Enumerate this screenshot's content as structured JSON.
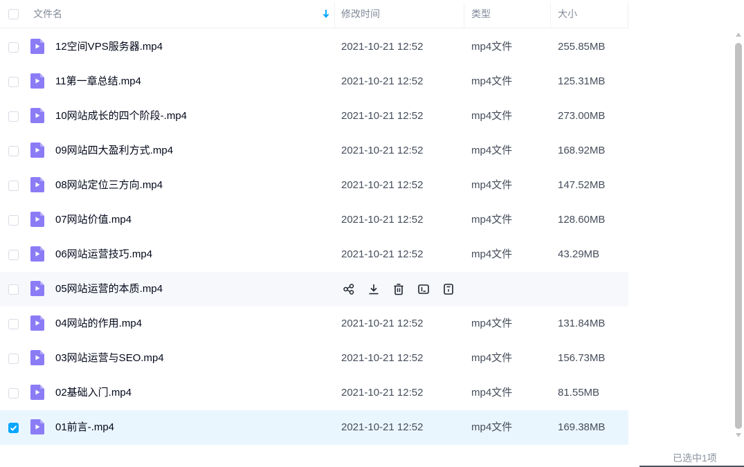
{
  "header": {
    "name_label": "文件名",
    "time_label": "修改时间",
    "type_label": "类型",
    "size_label": "大小",
    "sort_color": "#06a7ff"
  },
  "files": [
    {
      "name": "12空间VPS服务器.mp4",
      "time": "2021-10-21 12:52",
      "type": "mp4文件",
      "size": "255.85MB",
      "checked": false,
      "state": "normal"
    },
    {
      "name": "11第一章总结.mp4",
      "time": "2021-10-21 12:52",
      "type": "mp4文件",
      "size": "125.31MB",
      "checked": false,
      "state": "normal"
    },
    {
      "name": "10网站成长的四个阶段-.mp4",
      "time": "2021-10-21 12:52",
      "type": "mp4文件",
      "size": "273.00MB",
      "checked": false,
      "state": "normal"
    },
    {
      "name": "09网站四大盈利方式.mp4",
      "time": "2021-10-21 12:52",
      "type": "mp4文件",
      "size": "168.92MB",
      "checked": false,
      "state": "normal"
    },
    {
      "name": "08网站定位三方向.mp4",
      "time": "2021-10-21 12:52",
      "type": "mp4文件",
      "size": "147.52MB",
      "checked": false,
      "state": "normal"
    },
    {
      "name": "07网站价值.mp4",
      "time": "2021-10-21 12:52",
      "type": "mp4文件",
      "size": "128.60MB",
      "checked": false,
      "state": "normal"
    },
    {
      "name": "06网站运营技巧.mp4",
      "time": "2021-10-21 12:52",
      "type": "mp4文件",
      "size": "43.29MB",
      "checked": false,
      "state": "normal"
    },
    {
      "name": "05网站运营的本质.mp4",
      "time": "",
      "type": "",
      "size": "",
      "checked": false,
      "state": "hover"
    },
    {
      "name": "04网站的作用.mp4",
      "time": "2021-10-21 12:52",
      "type": "mp4文件",
      "size": "131.84MB",
      "checked": false,
      "state": "normal"
    },
    {
      "name": "03网站运营与SEO.mp4",
      "time": "2021-10-21 12:52",
      "type": "mp4文件",
      "size": "156.73MB",
      "checked": false,
      "state": "normal"
    },
    {
      "name": "02基础入门.mp4",
      "time": "2021-10-21 12:52",
      "type": "mp4文件",
      "size": "81.55MB",
      "checked": false,
      "state": "normal"
    },
    {
      "name": "01前言-.mp4",
      "time": "2021-10-21 12:52",
      "type": "mp4文件",
      "size": "169.38MB",
      "checked": true,
      "state": "selected"
    }
  ],
  "hover_actions": [
    "share-icon",
    "download-icon",
    "delete-icon",
    "rename-icon",
    "more-icon"
  ],
  "footer": {
    "selected_count": "已选中1项"
  },
  "colors": {
    "accent": "#06a7ff",
    "file_icon": "#8b7cf6",
    "selected_row": "#eaf6fe",
    "hover_row": "#f6f8fb"
  }
}
